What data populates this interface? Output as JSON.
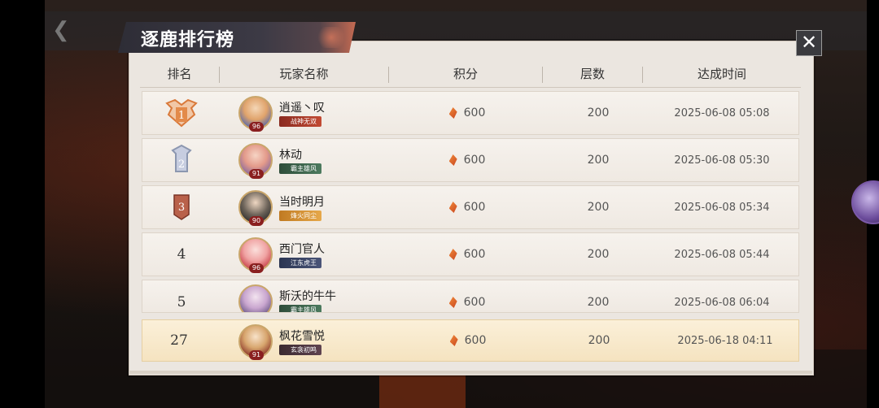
{
  "title": "逐鹿排行榜",
  "close_icon": "✕",
  "headers": {
    "rank": "排名",
    "player": "玩家名称",
    "score": "积分",
    "floors": "层数",
    "time": "达成时间"
  },
  "rows": [
    {
      "rank": "1",
      "badge": "gold-rank-icon",
      "name": "逍遥丶叹",
      "level": "96",
      "tag": "战神无双",
      "tag_color": "red",
      "score": "600",
      "floors": "200",
      "time": "2025-06-08 05:08"
    },
    {
      "rank": "2",
      "badge": "silver-rank-icon",
      "name": "林动",
      "level": "91",
      "tag": "霸主雄风",
      "tag_color": "green",
      "score": "600",
      "floors": "200",
      "time": "2025-06-08 05:30"
    },
    {
      "rank": "3",
      "badge": "bronze-rank-icon",
      "name": "当时明月",
      "level": "90",
      "tag": "烽火同尘",
      "tag_color": "gold",
      "score": "600",
      "floors": "200",
      "time": "2025-06-08 05:34"
    },
    {
      "rank": "4",
      "name": "西门官人",
      "level": "96",
      "tag": "江东虎王",
      "tag_color": "navy",
      "score": "600",
      "floors": "200",
      "time": "2025-06-08 05:44"
    },
    {
      "rank": "5",
      "name": "斯沃的牛牛",
      "level": "",
      "tag": "霸主雄风",
      "tag_color": "green",
      "score": "600",
      "floors": "200",
      "time": "2025-06-08 06:04"
    }
  ],
  "me": {
    "rank": "27",
    "name": "枫花雪悦",
    "level": "91",
    "tag": "玄衾初鸣",
    "tag_color": "dark",
    "score": "600",
    "floors": "200",
    "time": "2025-06-18 04:11"
  },
  "colors": {
    "score_gem": "#e0662c",
    "gold_badge": "#d9793a",
    "silver_badge": "#8c97b0",
    "bronze_badge": "#a8553a",
    "highlight_row": "#f5e3c0"
  }
}
